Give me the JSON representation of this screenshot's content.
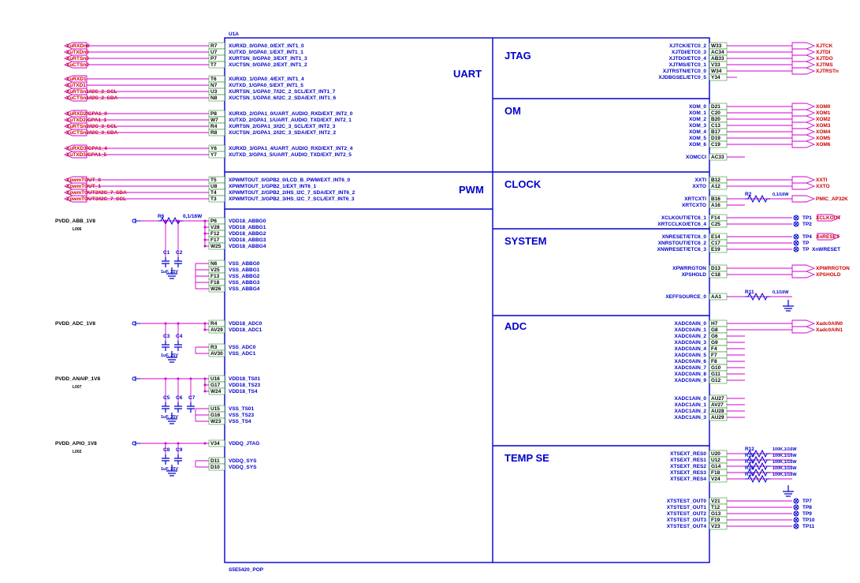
{
  "component": {
    "refdes": "U1A",
    "footprint": "S5E5420_POP"
  },
  "blocks": [
    "UART",
    "PWM",
    "OM",
    "CLOCK",
    "SYSTEM",
    "ADC",
    "TEMP SE",
    "JTAG"
  ],
  "left_nets": {
    "grp0": [
      {
        "n": "XuRXDn0",
        "p": "R7"
      },
      {
        "n": "XuTXDn0",
        "p": "U7"
      },
      {
        "n": "XuRTSn0",
        "p": "P7"
      },
      {
        "n": "XuCTSn0",
        "p": "T7"
      }
    ],
    "grp1": [
      {
        "n": "XuRXD1",
        "p": "T6"
      },
      {
        "n": "XuTXD1",
        "p": "N7"
      },
      {
        "n": "XuRTSn1/I2C_2_SCL",
        "p": "U3"
      },
      {
        "n": "XuCTSn1/I2C_2_SDA",
        "p": "N8"
      }
    ],
    "grp2": [
      {
        "n": "XuRXD2/GPA1_0",
        "p": "P8"
      },
      {
        "n": "XuTXD2/GPA1_1",
        "p": "W7"
      },
      {
        "n": "XuRTSn2/I2C_3_SCL",
        "p": "R4"
      },
      {
        "n": "XuCTSn2/I2C_3_SDA",
        "p": "R8"
      }
    ],
    "grp3": [
      {
        "n": "XuRXD3/GPA1_4",
        "p": "Y6"
      },
      {
        "n": "XuTXD3/GPA1_5",
        "p": "Y7"
      }
    ],
    "pwm": [
      {
        "n": "XpwmTOUT_0",
        "p": "T5"
      },
      {
        "n": "XpwmTOUT_1",
        "p": "U8"
      },
      {
        "n": "XpwmTOUT2/I2C_7_SDA",
        "p": "T4"
      },
      {
        "n": "XpwmTOUT3/I2C_7_SCL",
        "p": "T3"
      }
    ]
  },
  "uart_pins": {
    "u0": [
      "XURXD_0/GPA0_0/EXT_INT1_0",
      "XUTXD_0/GPA0_1/EXT_INT1_1",
      "XURTSN_0/GPA0_3/EXT_INT1_3",
      "XUCTSN_0/GPA0_2/EXT_INT1_2"
    ],
    "u1": [
      "XURXD_1/GPA0_4/EXT_INT1_4",
      "XUTXD_1/GPA0_5/EXT_INT1_5",
      "XURTSN_1/GPA0_7/I2C_2_SCL/EXT_INT1_7",
      "XUCTSN_1/GPA0_6/I2C_2_SDA/EXT_INT1_6"
    ],
    "u2": [
      "XURXD_2/GPA1_0/UART_AUDIO_RXD/EXT_INT2_0",
      "XUTXD_2/GPA1_1/UART_AUDIO_TXD/EXT_INT2_1",
      "XURTSN_2/GPA1_3/I2C_3_SCL/EXT_INT2_3",
      "XUCTSN_2/GPA1_2/I2C_3_SDA/EXT_INT2_2"
    ],
    "u3": [
      "XURXD_3/GPA1_4/UART_AUDIO_RXD/EXT_INT2_4",
      "XUTXD_3/GPA1_5/UART_AUDIO_TXD/EXT_INT2_5"
    ],
    "pwm": [
      "XPWMTOUT_0/GPB2_0/LCD_B_PWM/EXT_INT6_0",
      "XPWMTOUT_1/GPB2_1/EXT_INT6_1",
      "XPWMTOUT_2/GPB2_2/HS_I2C_7_SDA/EXT_INT6_2",
      "XPWMTOUT_3/GPB2_3/HS_I2C_7_SCL/EXT_INT6_3"
    ]
  },
  "pwr": [
    {
      "net": "PVDD_ABB_1V8",
      "sub": "L006",
      "r": "R6",
      "rval": "0,1/16W",
      "pins": [
        "P6",
        "V28",
        "F12",
        "F17",
        "W25"
      ],
      "signals": [
        "VDD18_ABBG0",
        "VDD18_ABBG1",
        "VDD18_ABBG2",
        "VDD18_ABBG3",
        "VDD18_ABBG4"
      ],
      "caps": [
        "C1",
        "C2"
      ],
      "cval": "1uF, 25V",
      "gpins": [
        "N6",
        "V25",
        "F13",
        "F18",
        "W26"
      ],
      "gsignals": [
        "VSS_ABBG0",
        "VSS_ABBG1",
        "VSS_ABBG2",
        "VSS_ABBG3",
        "VSS_ABBG4"
      ]
    },
    {
      "net": "PVDD_ADC_1V8",
      "sub": "",
      "pins": [
        "R4",
        "AV29"
      ],
      "signals": [
        "VDD18_ADC0",
        "VDD18_ADC1"
      ],
      "caps": [
        "C3",
        "C4"
      ],
      "cval": "1uF, 25V",
      "gpins": [
        "R3",
        "AV30"
      ],
      "gsignals": [
        "VSS_ADC0",
        "VSS_ADC1"
      ]
    },
    {
      "net": "PVDD_ANAIP_1V8",
      "sub": "L007",
      "pins": [
        "U16",
        "G17",
        "W24"
      ],
      "signals": [
        "VDD18_TS01",
        "VDD18_TS23",
        "VDD18_TS4"
      ],
      "caps": [
        "C5",
        "C6",
        "C7"
      ],
      "cval": "1uF, 25V",
      "gpins": [
        "U15",
        "G16",
        "W23"
      ],
      "gsignals": [
        "VSS_TS01",
        "VSS_TS23",
        "VSS_TS4"
      ]
    },
    {
      "net": "PVDD_APIO_1V8",
      "sub": "L002",
      "pins": [
        "V34"
      ],
      "signals": [
        "VDDQ_JTAG"
      ],
      "caps": [
        "C8",
        "C9"
      ],
      "cval": "1uF, 25V",
      "gpins": [
        "D11",
        "D10"
      ],
      "gsignals": [
        "VDDQ_SYS",
        "VDDQ_SYS"
      ]
    }
  ],
  "jtag": {
    "pins": [
      {
        "s": "XJTCK/ETC0_2",
        "p": "W33",
        "n": "XJTCK"
      },
      {
        "s": "XJTDI/ETC0_3",
        "p": "AC34",
        "n": "XJTDI"
      },
      {
        "s": "XJTDO/ETC0_4",
        "p": "AB33",
        "n": "XJTDO"
      },
      {
        "s": "XJTMS/ETC0_1",
        "p": "V33",
        "n": "XJTMS"
      },
      {
        "s": "XJTRSTN/ETC0_0",
        "p": "W34",
        "n": "XJTRSTn"
      },
      {
        "s": "XJDBGSEL/ETC0_5",
        "p": "Y34",
        "n": ""
      }
    ],
    "title": "JTAG"
  },
  "om": {
    "title": "OM",
    "pins": [
      {
        "s": "XOM_0",
        "p": "D21",
        "n": "XOM0"
      },
      {
        "s": "XOM_1",
        "p": "C20",
        "n": "XOM1"
      },
      {
        "s": "XOM_2",
        "p": "B20",
        "n": "XOM2"
      },
      {
        "s": "XOM_3",
        "p": "C13",
        "n": "XOM3"
      },
      {
        "s": "XOM_4",
        "p": "B17",
        "n": "XOM4"
      },
      {
        "s": "XOM_5",
        "p": "D19",
        "n": "XOM5"
      },
      {
        "s": "XOM_6",
        "p": "C19",
        "n": "XOM6"
      }
    ],
    "extra": {
      "s": "XOMCCI",
      "p": "AC33"
    }
  },
  "clock": {
    "title": "CLOCK",
    "rows": [
      {
        "s": "XXTI",
        "p": "B12",
        "n": "XXTI"
      },
      {
        "s": "XXTO",
        "p": "A12",
        "n": "XXTO"
      },
      {
        "s": "XRTCXTI",
        "p": "B16",
        "n": "",
        "r": "R2",
        "rv": "0,1/16W",
        "out": "PMIC_AP32K"
      },
      {
        "s": "XRTCXTO",
        "p": "A16",
        "n": ""
      },
      {
        "s": "XCLKOUT/ETC6_1",
        "p": "F14",
        "n": "XCLKOUT",
        "tp": "TP1"
      },
      {
        "s": "XRTCCLKO/ETC6_4",
        "p": "C25",
        "n": "",
        "tp": "TP2"
      }
    ]
  },
  "system": {
    "title": "SYSTEM",
    "rows": [
      {
        "s": "XNRESET/ETC6_0",
        "p": "E14",
        "n": "XnRESET",
        "tp": "TP4"
      },
      {
        "s": "XNRSTOUT/ETC6_2",
        "p": "C17",
        "tp": ""
      },
      {
        "s": "XNWRESET/ETC6_3",
        "p": "E19",
        "n": "XnWRESET",
        "tp": "TP"
      },
      {
        "s": "XPWRRGTON",
        "p": "D13",
        "n": "XPWRRGTON"
      },
      {
        "s": "XPSHOLD",
        "p": "C18",
        "n": "XPSHOLD"
      },
      {
        "s": "XEFFSOURCE_0",
        "p": "AA1",
        "r": "R11",
        "rv": "0,1/16W"
      }
    ]
  },
  "adc": {
    "title": "ADC",
    "ch0": [
      {
        "s": "XADC0AIN_0",
        "p": "H7",
        "n": "Xadc0AIN0"
      },
      {
        "s": "XADC0AIN_1",
        "p": "G8",
        "n": "Xadc0AIN1"
      },
      {
        "s": "XADC0AIN_2",
        "p": "G6"
      },
      {
        "s": "XADC0AIN_3",
        "p": "G9"
      },
      {
        "s": "XADC0AIN_4",
        "p": "F4"
      },
      {
        "s": "XADC0AIN_5",
        "p": "F7"
      },
      {
        "s": "XADC0AIN_6",
        "p": "F8"
      },
      {
        "s": "XADC0AIN_7",
        "p": "G10"
      },
      {
        "s": "XADC0AIN_8",
        "p": "G11"
      },
      {
        "s": "XADC0AIN_9",
        "p": "G12"
      }
    ],
    "ch1": [
      {
        "s": "XADC1AIN_0",
        "p": "AU27"
      },
      {
        "s": "XADC1AIN_1",
        "p": "AV27"
      },
      {
        "s": "XADC1AIN_2",
        "p": "AU28"
      },
      {
        "s": "XADC1AIN_3",
        "p": "AU29"
      }
    ]
  },
  "temp": {
    "title": "TEMP SE",
    "res_rows": [
      {
        "s": "XTSEXT_RES0",
        "p": "U20",
        "r": "R12",
        "rv": "100K,1/16W"
      },
      {
        "s": "XTSEXT_RES1",
        "p": "U12",
        "r": "R13",
        "rv": "100K,1/16W"
      },
      {
        "s": "XTSEXT_RES2",
        "p": "G14",
        "r": "R16",
        "rv": "100K,1/16W"
      },
      {
        "s": "XTSEXT_RES3",
        "p": "F18",
        "r": "R18",
        "rv": "100K,1/16W"
      },
      {
        "s": "XTSEXT_RES4",
        "p": "V24",
        "r": "R14",
        "rv": "100K,1/16W"
      }
    ],
    "tp_rows": [
      {
        "s": "XTSTEST_OUT0",
        "p": "V21",
        "tp": "TP7"
      },
      {
        "s": "XTSTEST_OUT1",
        "p": "T12",
        "tp": "TP8"
      },
      {
        "s": "XTSTEST_OUT2",
        "p": "G13",
        "tp": "TP9"
      },
      {
        "s": "XTSTEST_OUT3",
        "p": "F19",
        "tp": "TP10"
      },
      {
        "s": "XTSTEST_OUT4",
        "p": "V23",
        "tp": "TP11"
      }
    ]
  }
}
